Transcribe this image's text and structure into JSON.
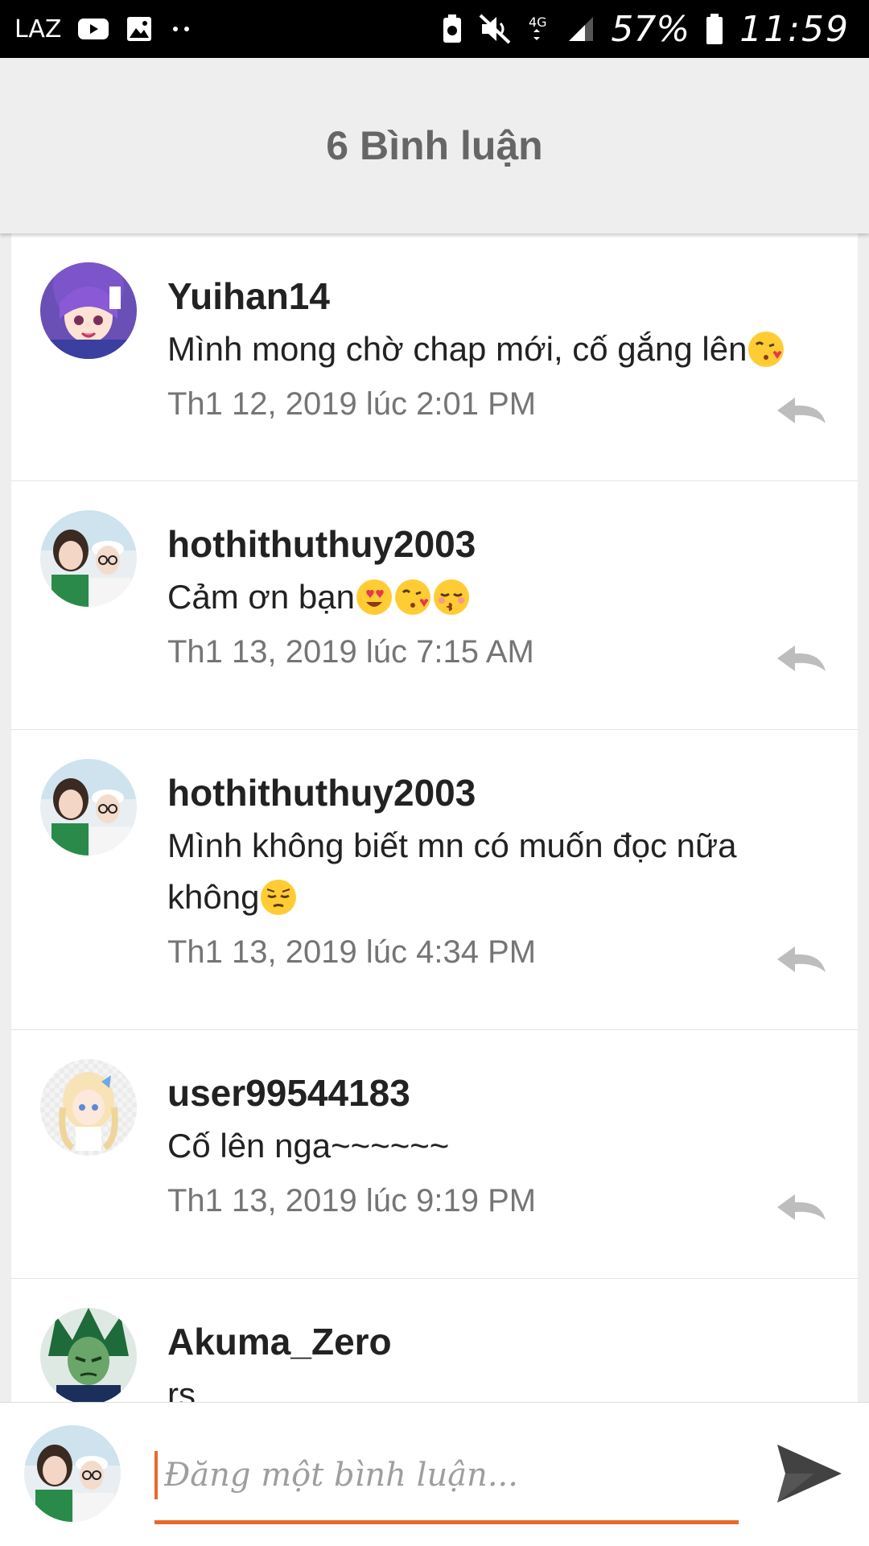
{
  "status_bar": {
    "carrier": "LAZ",
    "network": "4G",
    "battery": "57%",
    "time": "11:59"
  },
  "header": {
    "title": "6 Bình luận"
  },
  "comments": [
    {
      "username": "Yuihan14",
      "text": "Mình mong chờ chap mới, cố gắng lên",
      "emojis": [
        "kissing-heart"
      ],
      "time": "Th1 12, 2019 lúc 2:01 PM",
      "avatar": "anime-girl-purple-avatar"
    },
    {
      "username": "hothithuthuy2003",
      "text": "Cảm ơn bạn",
      "emojis": [
        "heart-eyes",
        "kissing-heart",
        "kissing-closed-eyes"
      ],
      "time": "Th1 13, 2019 lúc 7:15 AM",
      "avatar": "photo-two-girls-avatar"
    },
    {
      "username": "hothithuthuy2003",
      "text_line1": "Mình không biết mn có muốn đọc nữa",
      "text_line2": "không",
      "emojis": [
        "pensive"
      ],
      "time": "Th1 13, 2019 lúc 4:34 PM",
      "avatar": "photo-two-girls-avatar"
    },
    {
      "username": "user99544183",
      "text": "Cố lên nga~~~~~~",
      "emojis": [],
      "time": "Th1 13, 2019 lúc 9:19 PM",
      "avatar": "anime-blonde-girl-avatar"
    },
    {
      "username": "Akuma_Zero",
      "text": "rs",
      "avatar": "anime-green-character-avatar"
    }
  ],
  "footer": {
    "placeholder": "Đăng một bình luận...",
    "avatar": "photo-two-girls-avatar"
  },
  "colors": {
    "accent": "#e8692c",
    "header_bg": "#eeeeee",
    "header_text": "#666666",
    "time_text": "#757575"
  }
}
